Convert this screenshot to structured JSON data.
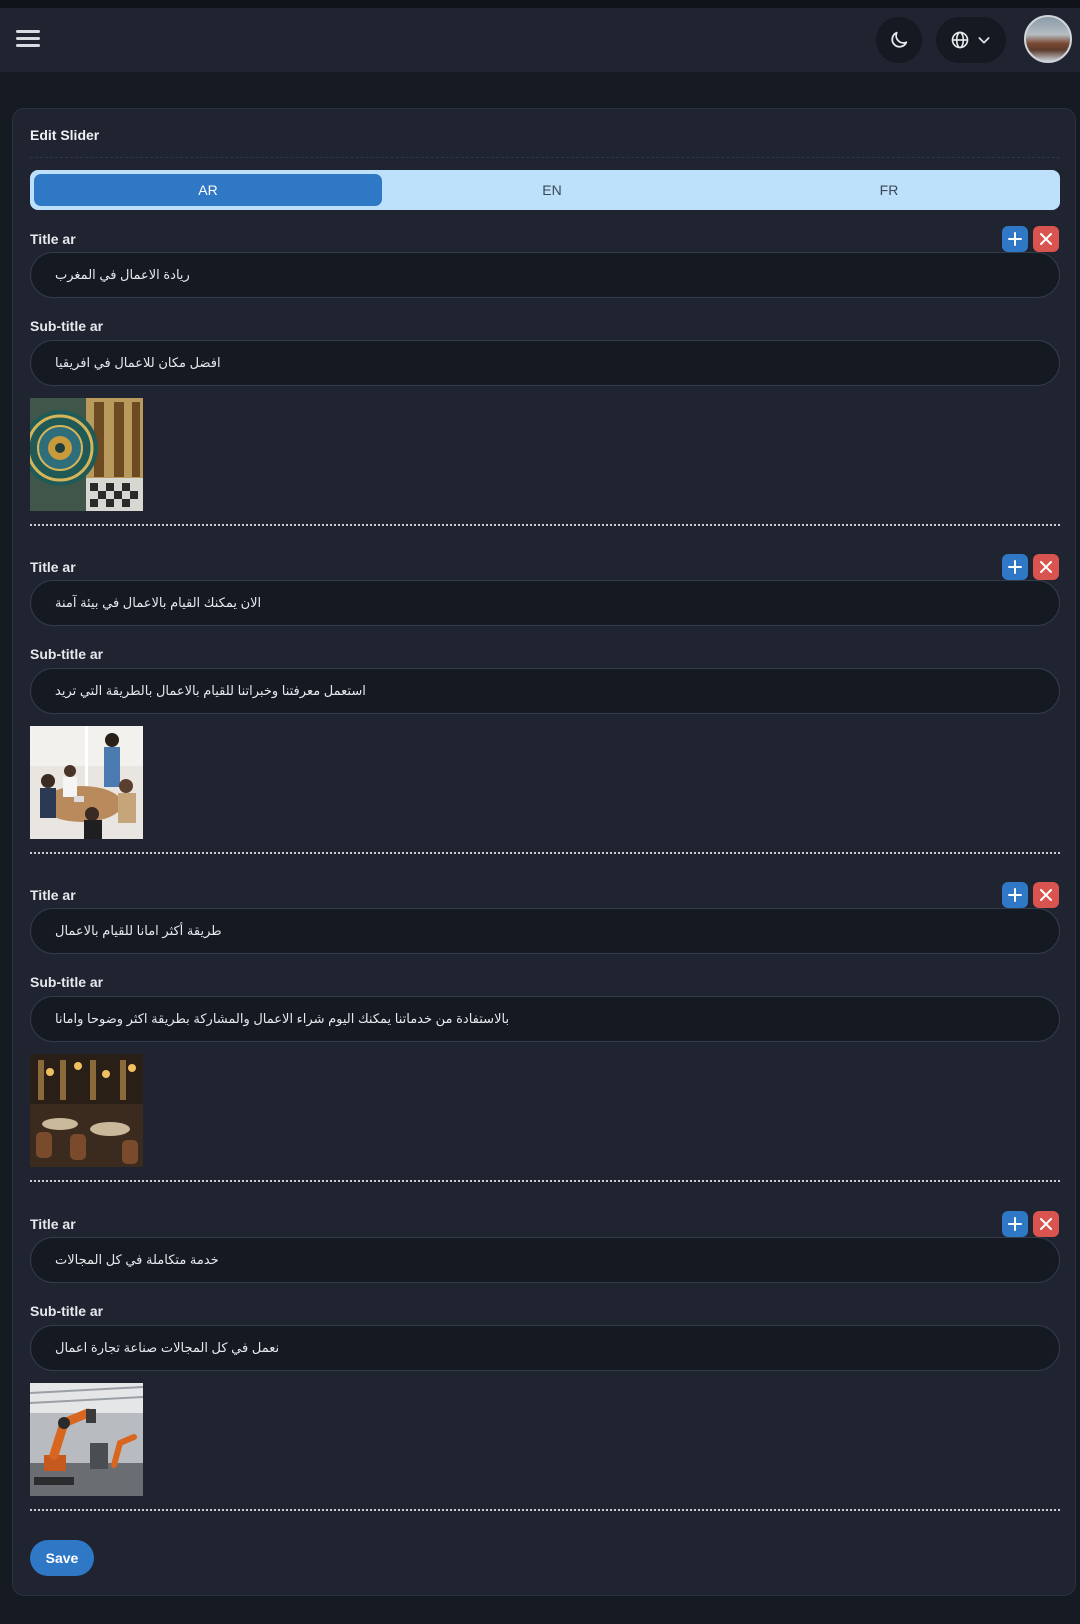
{
  "card": {
    "title": "Edit Slider",
    "save_label": "Save"
  },
  "tabs": [
    {
      "label": "AR",
      "active": true
    },
    {
      "label": "EN",
      "active": false
    },
    {
      "label": "FR",
      "active": false
    }
  ],
  "items": [
    {
      "title_label": "Title ar",
      "title_value": "ريادة الاعمال في المغرب",
      "subtitle_label": "Sub-title ar",
      "subtitle_value": "افضل مكان للاعمال في افريقيا",
      "image": "moroccan-architecture-image"
    },
    {
      "title_label": "Title ar",
      "title_value": "الان يمكنك القيام بالاعمال في بيئة آمنة",
      "subtitle_label": "Sub-title ar",
      "subtitle_value": "استعمل معرفتنا وخبراتنا للقيام بالاعمال بالطريقة التي تريد",
      "image": "business-meeting-image"
    },
    {
      "title_label": "Title ar",
      "title_value": "طريقة أكثر امانا للقيام بالاعمال",
      "subtitle_label": "Sub-title ar",
      "subtitle_value": "بالاستفادة من خدماتنا يمكنك اليوم شراء الاعمال والمشاركة بطريقة اكثر وضوحا وامانا",
      "image": "restaurant-interior-image"
    },
    {
      "title_label": "Title ar",
      "title_value": "خدمة متكاملة في كل المجالات",
      "subtitle_label": "Sub-title ar",
      "subtitle_value": "نعمل في كل المجالات صناعة تجارة اعمال",
      "image": "industrial-robot-image"
    }
  ],
  "colors": {
    "accent": "#2e78c6",
    "danger": "#d9534f",
    "tab_bar": "#bde0fb",
    "background": "#161a22",
    "surface": "#1f2430"
  }
}
